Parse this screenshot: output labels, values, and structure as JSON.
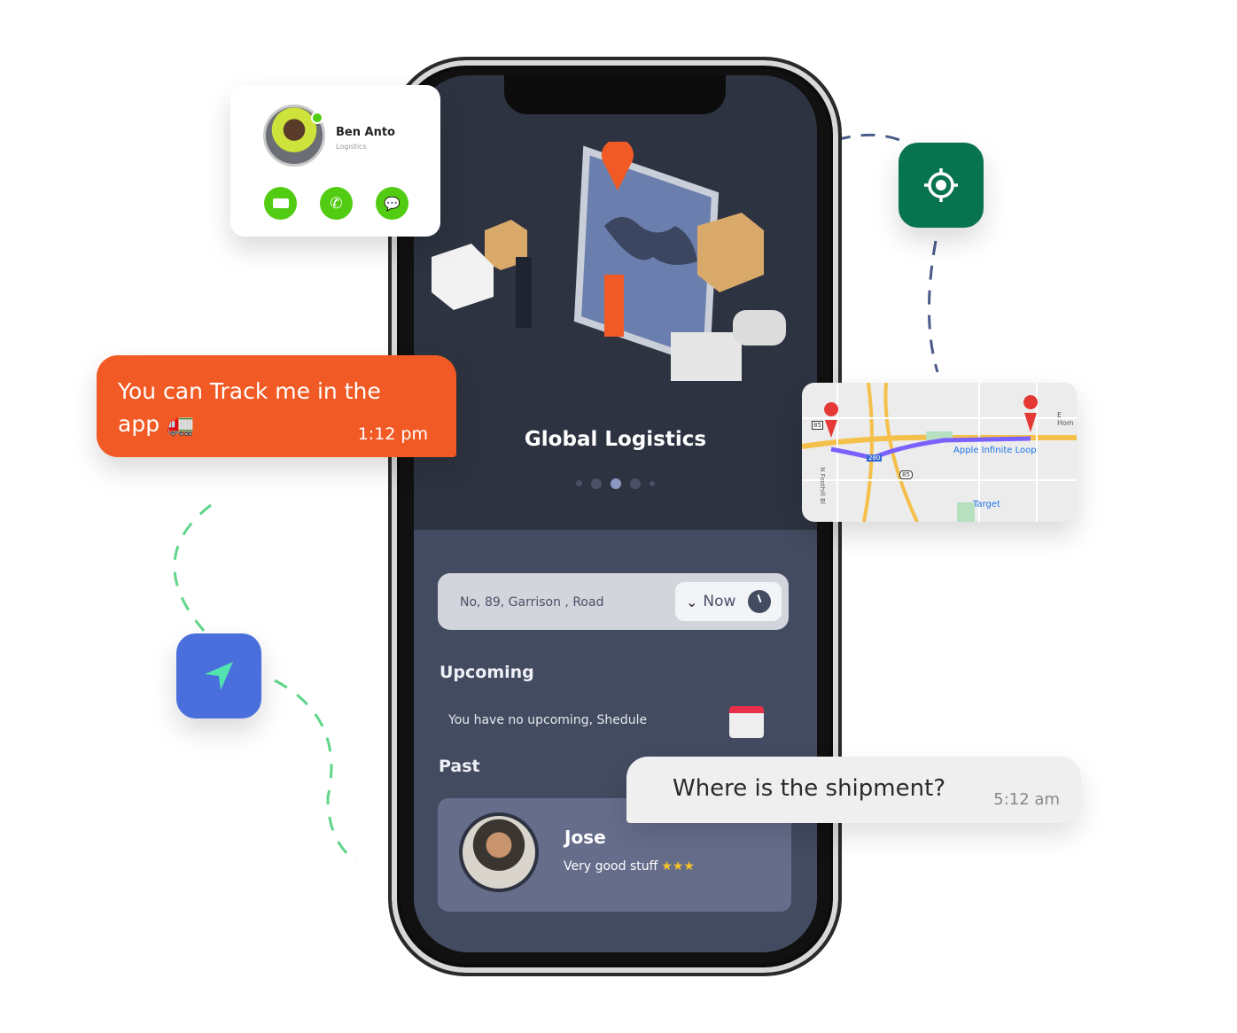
{
  "contact_card": {
    "name": "Ben Anto",
    "role": "Logistics",
    "status_color": "#52cc12",
    "actions": [
      "video-call",
      "phone-call",
      "wechat"
    ]
  },
  "chat_orange": {
    "message": "You can Track me in the app 🚛",
    "time": "1:12 pm",
    "color": "#f15a24"
  },
  "chat_white": {
    "message": "Where is the shipment?",
    "time": "5:12 am"
  },
  "map": {
    "labels": [
      "Apple Infinite Loop",
      "Target",
      "E Hom",
      "N Foothill Bl",
      "280",
      "85",
      "85"
    ],
    "route_color": "#7b61ff"
  },
  "app": {
    "title": "Global Logistics",
    "carousel": {
      "count": 5,
      "active": 2
    },
    "address": "No, 89, Garrison , Road",
    "time_select": "Now",
    "upcoming": {
      "heading": "Upcoming",
      "empty_text": "You have no upcoming, Shedule"
    },
    "past": {
      "heading": "Past",
      "name": "Jose",
      "review": "Very good stuff",
      "stars": 3
    }
  },
  "colors": {
    "locate_button": "#08734f",
    "nav_button": "#4a6fdc"
  }
}
